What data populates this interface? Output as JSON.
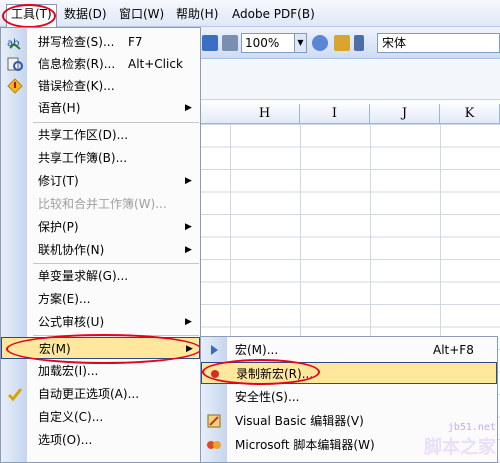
{
  "menubar": {
    "items": [
      "工具(T)",
      "数据(D)",
      "窗口(W)",
      "帮助(H)",
      "Adobe PDF(B)"
    ]
  },
  "toolbar": {
    "zoom": "100%",
    "font": "宋体"
  },
  "columns": [
    "H",
    "I",
    "J",
    "K"
  ],
  "tools_menu": {
    "items": [
      {
        "label": "拼写检查(S)...",
        "shortcut": "F7"
      },
      {
        "label": "信息检索(R)...",
        "shortcut": "Alt+Click"
      },
      {
        "label": "错误检查(K)..."
      },
      {
        "label": "语音(H)"
      },
      {
        "label": "共享工作区(D)..."
      },
      {
        "label": "共享工作簿(B)..."
      },
      {
        "label": "修订(T)"
      },
      {
        "label": "比较和合并工作簿(W)..."
      },
      {
        "label": "保护(P)"
      },
      {
        "label": "联机协作(N)"
      },
      {
        "label": "单变量求解(G)..."
      },
      {
        "label": "方案(E)..."
      },
      {
        "label": "公式审核(U)"
      },
      {
        "label": "宏(M)"
      },
      {
        "label": "加载宏(I)..."
      },
      {
        "label": "自动更正选项(A)..."
      },
      {
        "label": "自定义(C)..."
      },
      {
        "label": "选项(O)..."
      }
    ]
  },
  "macro_submenu": {
    "items": [
      {
        "label": "宏(M)...",
        "shortcut": "Alt+F8"
      },
      {
        "label": "录制新宏(R)..."
      },
      {
        "label": "安全性(S)..."
      },
      {
        "label": "Visual Basic 编辑器(V)"
      },
      {
        "label": "Microsoft 脚本编辑器(W)"
      }
    ]
  },
  "watermark": {
    "url": "jb51.net",
    "name": "脚本之家"
  }
}
